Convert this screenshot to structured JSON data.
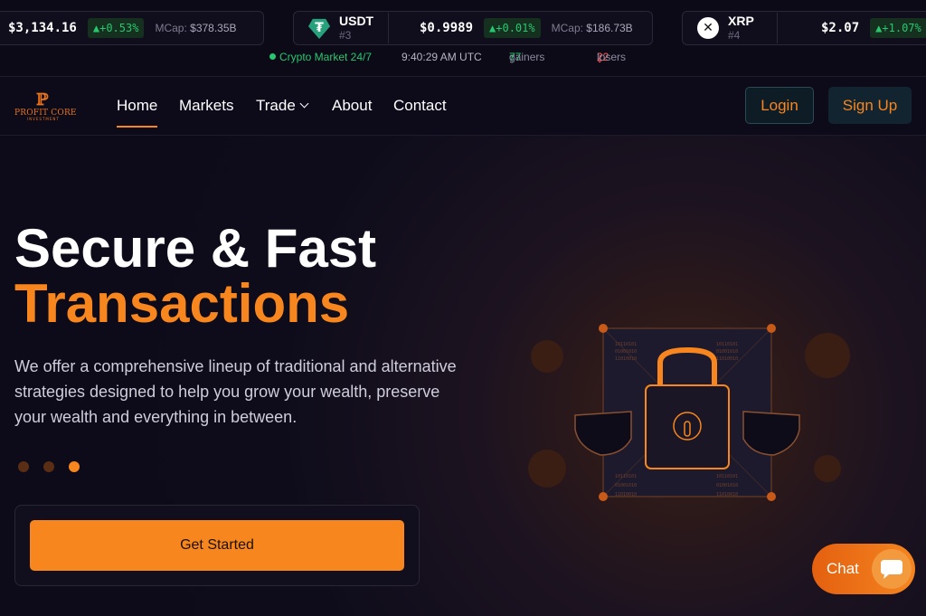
{
  "ticker": {
    "cards": [
      {
        "symbol": "",
        "rank": "",
        "price": "$3,134.16",
        "change": "+0.53%",
        "mcap_label": "MCap:",
        "mcap_value": "$378.35B"
      },
      {
        "symbol": "USDT",
        "rank": "#3",
        "price": "$0.9989",
        "change": "+0.01%",
        "mcap_label": "MCap:",
        "mcap_value": "$186.73B"
      },
      {
        "symbol": "XRP",
        "rank": "#4",
        "price": "$2.07",
        "change": "+1.07%",
        "mcap_label": "",
        "mcap_value": ""
      }
    ],
    "status": {
      "market": "Crypto Market 24/7",
      "time": "9:40:29 AM UTC",
      "gainers_count": "77",
      "gainers_label": "gainers",
      "losers_count": "22",
      "losers_label": "losers"
    }
  },
  "nav": {
    "logo_text": "PROFIT CORE",
    "logo_sub": "INVESTMENT",
    "links": [
      "Home",
      "Markets",
      "Trade",
      "About",
      "Contact"
    ],
    "login": "Login",
    "signup": "Sign Up"
  },
  "hero": {
    "title_line1": "Secure & Fast",
    "title_line2": "Transactions",
    "description": "We offer a comprehensive lineup of traditional and alternative strategies designed to help you grow your wealth, preserve your wealth and everything in between.",
    "carousel_total": 3,
    "carousel_active": 3,
    "cta": "Get Started",
    "binary_rows": [
      "10110101",
      "01001010",
      "11010010"
    ]
  },
  "chat": {
    "label": "Chat"
  },
  "colors": {
    "accent": "#f7861e",
    "background": "#0d0b1a",
    "positive": "#28c76f",
    "negative": "#ff5a5a"
  },
  "icons": [
    "tether-icon",
    "xrp-icon",
    "arrow-up-icon",
    "arrow-down-icon",
    "chevron-down-icon",
    "lock-icon",
    "shield-icon",
    "chat-bubble-icon"
  ]
}
